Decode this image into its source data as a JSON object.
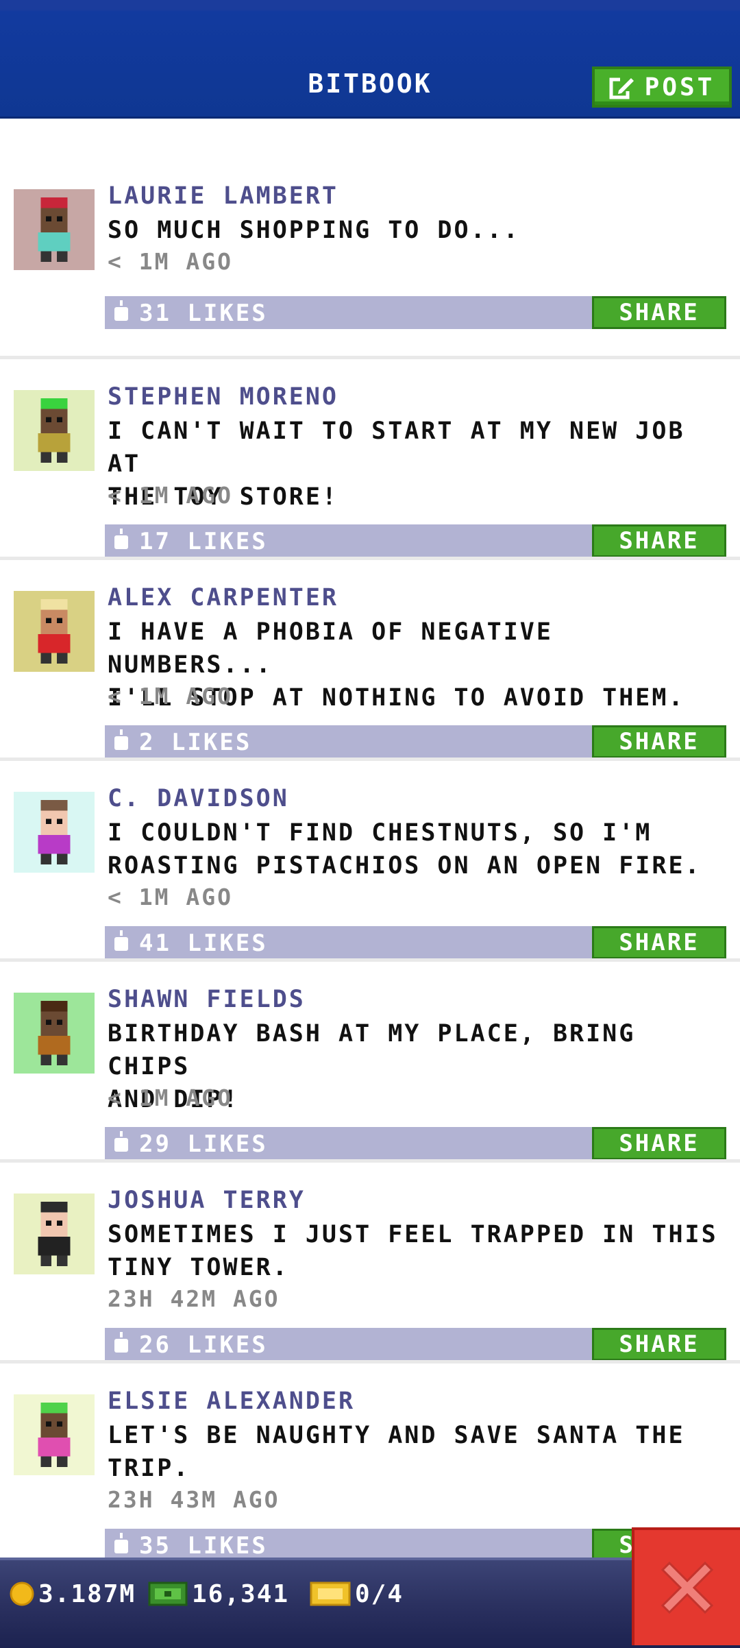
{
  "header": {
    "title": "BITBOOK",
    "post_label": "POST"
  },
  "posts": [
    {
      "name": "LAURIE LAMBERT",
      "lines": [
        "SO MUCH SHOPPING TO DO..."
      ],
      "time": "< 1M AGO",
      "likes": "31 LIKES",
      "share": "SHARE",
      "avatar_bg": "#c7a7a5"
    },
    {
      "name": "STEPHEN MORENO",
      "lines": [
        "I CAN'T WAIT TO START AT MY NEW JOB AT",
        "THE TOY STORE!"
      ],
      "time": "< 1M AGO",
      "likes": "17 LIKES",
      "share": "SHARE",
      "avatar_bg": "#e2eebd"
    },
    {
      "name": "ALEX CARPENTER",
      "lines": [
        "I HAVE A PHOBIA OF NEGATIVE NUMBERS...",
        "I'LL STOP AT NOTHING TO AVOID THEM."
      ],
      "time": "< 1M AGO",
      "likes": "2 LIKES",
      "share": "SHARE",
      "avatar_bg": "#d9d184"
    },
    {
      "name": "C. DAVIDSON",
      "lines": [
        "I COULDN'T FIND CHESTNUTS, SO I'M",
        "ROASTING PISTACHIOS ON AN OPEN FIRE."
      ],
      "time": "< 1M AGO",
      "likes": "41 LIKES",
      "share": "SHARE",
      "avatar_bg": "#d9f7f3"
    },
    {
      "name": "SHAWN FIELDS",
      "lines": [
        "BIRTHDAY BASH AT MY PLACE, BRING CHIPS",
        "AND DIP!"
      ],
      "time": "< 1M AGO",
      "likes": "29 LIKES",
      "share": "SHARE",
      "avatar_bg": "#9de69a"
    },
    {
      "name": "JOSHUA TERRY",
      "lines": [
        "SOMETIMES I JUST FEEL TRAPPED IN THIS",
        "TINY TOWER."
      ],
      "time": "23H 42M AGO",
      "likes": "26 LIKES",
      "share": "SHARE",
      "avatar_bg": "#e9f1c2"
    },
    {
      "name": "ELSIE ALEXANDER",
      "lines": [
        "LET'S BE NAUGHTY AND SAVE SANTA THE",
        "TRIP."
      ],
      "time": "23H 43M AGO",
      "likes": "35 LIKES",
      "share": "SHARE",
      "avatar_bg": "#f1f7d2"
    }
  ],
  "footer": {
    "coins": "3.187M",
    "bux": "16,341",
    "tickets": "0/4"
  },
  "colors": {
    "header_blue": "#0f3792",
    "share_green": "#47a82b",
    "likes_bar": "#b2b3d3",
    "close_red": "#e4382f"
  }
}
